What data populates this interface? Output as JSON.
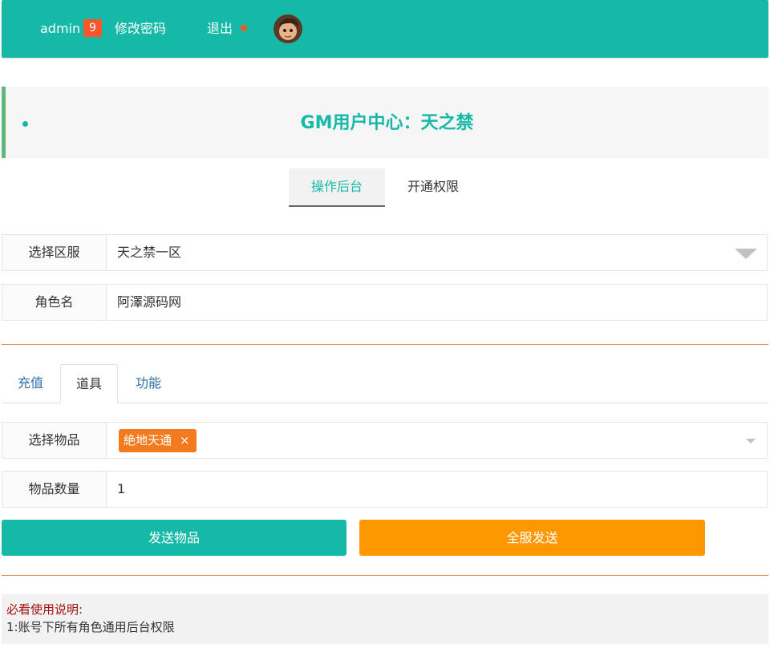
{
  "header": {
    "username": "admin",
    "badge_count": "9",
    "change_password": "修改密码",
    "logout": "退出",
    "colors": {
      "bar": "#16b8a7",
      "badge": "#f5562b"
    }
  },
  "banner": {
    "title": "GM用户中心：天之禁"
  },
  "top_tabs": [
    {
      "label": "操作后台",
      "active": true
    },
    {
      "label": "开通权限",
      "active": false
    }
  ],
  "server_select": {
    "label": "选择区服",
    "value": "天之禁一区"
  },
  "role_name": {
    "label": "角色名",
    "value": "阿澤源码网"
  },
  "sub_tabs": [
    {
      "label": "充值",
      "active": false
    },
    {
      "label": "道具",
      "active": true
    },
    {
      "label": "功能",
      "active": false
    }
  ],
  "item_select": {
    "label": "选择物品",
    "selected_tag": "絶地天通",
    "remove_glyph": "×"
  },
  "item_quantity": {
    "label": "物品数量",
    "value": "1"
  },
  "buttons": {
    "send": "发送物品",
    "send_all": "全服发送"
  },
  "notes": {
    "title": "必看使用说明",
    "colon": ":",
    "line1": "1:账号下所有角色通用后台权限"
  }
}
